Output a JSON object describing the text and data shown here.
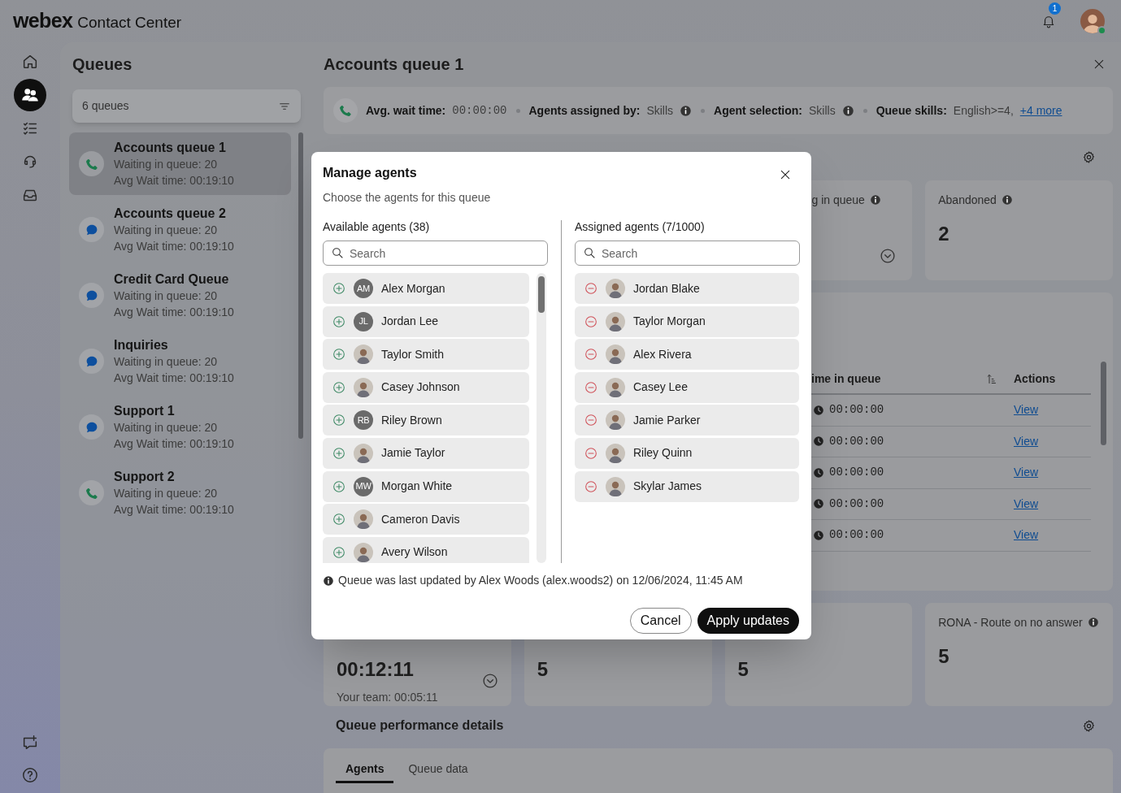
{
  "header": {
    "logo_bold": "webex",
    "logo_text": "Contact Center",
    "notifications": "1"
  },
  "rail": [
    {
      "kind": "home",
      "selected": false
    },
    {
      "kind": "people",
      "selected": true
    },
    {
      "kind": "tasks",
      "selected": false
    },
    {
      "kind": "headset",
      "selected": false
    },
    {
      "kind": "inbox",
      "selected": false
    }
  ],
  "rail_bottom": [
    {
      "kind": "feedback"
    },
    {
      "kind": "help"
    }
  ],
  "queues_panel": {
    "title": "Queues",
    "filter": "6 queues",
    "items": [
      {
        "name": "Accounts queue 1",
        "waiting": "Waiting in queue: 20",
        "avg": "Avg Wait time: 00:19:10",
        "kind": "phone",
        "selected": true
      },
      {
        "name": "Accounts queue 2",
        "waiting": "Waiting in queue: 20",
        "avg": "Avg Wait time: 00:19:10",
        "kind": "chat",
        "selected": false
      },
      {
        "name": "Credit Card Queue",
        "waiting": "Waiting in queue: 20",
        "avg": "Avg Wait time: 00:19:10",
        "kind": "chat",
        "selected": false
      },
      {
        "name": "Inquiries",
        "waiting": "Waiting in queue: 20",
        "avg": "Avg Wait time: 00:19:10",
        "kind": "chat",
        "selected": false
      },
      {
        "name": "Support 1",
        "waiting": "Waiting in queue: 20",
        "avg": "Avg Wait time: 00:19:10",
        "kind": "chat",
        "selected": false
      },
      {
        "name": "Support 2",
        "waiting": "Waiting in queue: 20",
        "avg": "Avg Wait time: 00:19:10",
        "kind": "phone",
        "selected": false
      }
    ]
  },
  "detail": {
    "title": "Accounts queue 1",
    "info": [
      {
        "label": "Avg. wait time:",
        "value": "00:00:00",
        "mono": true,
        "info": false
      },
      {
        "label": "Agents assigned by:",
        "value": "Skills",
        "mono": false,
        "info": true
      },
      {
        "label": "Agent selection:",
        "value": "Skills",
        "mono": false,
        "info": true
      },
      {
        "label": "Queue skills:",
        "value": "English>=4,",
        "mono": false,
        "info": false,
        "link": "+4 more"
      }
    ],
    "stats_top": [
      {
        "label": "g in queue",
        "info": true,
        "expandable": true
      },
      {
        "label": "Abandoned",
        "info": true,
        "value": "2",
        "expandable": false
      }
    ],
    "table": {
      "columns": [
        "ime in queue",
        "Actions"
      ],
      "rows": [
        {
          "time": "00:00:00",
          "action": "View"
        },
        {
          "time": "00:00:00",
          "action": "View"
        },
        {
          "time": "00:00:00",
          "action": "View"
        },
        {
          "time": "00:00:00",
          "action": "View"
        },
        {
          "time": "00:00:00",
          "action": "View"
        }
      ]
    },
    "stats_bottom": [
      {
        "value": "00:12:11",
        "note": "Your team: 00:05:11",
        "expandable": true
      },
      {
        "value": "5",
        "expandable": false
      },
      {
        "value": "5",
        "expandable": false
      },
      {
        "label": "RONA - Route on no answer",
        "info": true,
        "value": "5",
        "expandable": false
      }
    ],
    "performance": {
      "title": "Queue performance details",
      "tabs": [
        {
          "label": "Agents",
          "selected": true
        },
        {
          "label": "Queue data",
          "selected": false
        }
      ]
    }
  },
  "modal": {
    "title": "Manage agents",
    "subtitle": "Choose the agents for this queue",
    "available": {
      "heading": "Available agents (38)",
      "placeholder": "Search",
      "agents": [
        {
          "name": "Alex Morgan",
          "initials": "AM"
        },
        {
          "name": "Jordan Lee",
          "initials": "JL"
        },
        {
          "name": "Taylor Smith"
        },
        {
          "name": "Casey Johnson"
        },
        {
          "name": "Riley Brown",
          "initials": "RB"
        },
        {
          "name": "Jamie Taylor"
        },
        {
          "name": "Morgan White",
          "initials": "MW"
        },
        {
          "name": "Cameron Davis"
        },
        {
          "name": "Avery Wilson"
        }
      ]
    },
    "assigned": {
      "heading": "Assigned agents (7/1000)",
      "placeholder": "Search",
      "agents": [
        {
          "name": "Jordan Blake"
        },
        {
          "name": "Taylor Morgan"
        },
        {
          "name": "Alex Rivera"
        },
        {
          "name": "Casey Lee"
        },
        {
          "name": "Jamie Parker"
        },
        {
          "name": "Riley Quinn"
        },
        {
          "name": "Skylar James"
        }
      ]
    },
    "footnote": "Queue was last updated by Alex Woods (alex.woods2) on 12/06/2024, 11:45 AM",
    "buttons": [
      {
        "label": "Cancel",
        "kind": "secondary"
      },
      {
        "label": "Apply updates",
        "kind": "primary"
      }
    ]
  }
}
